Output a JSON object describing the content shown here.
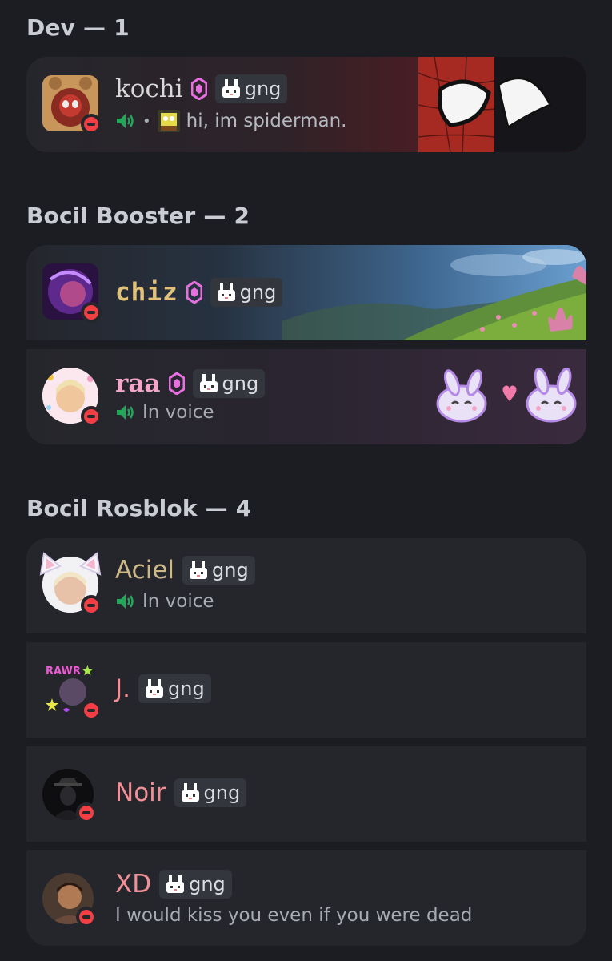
{
  "sections": [
    {
      "header": "Dev — 1"
    },
    {
      "header": "Bocil Booster — 2"
    },
    {
      "header": "Bocil Rosblok — 4"
    }
  ],
  "members": {
    "kochi": {
      "name": "kochi",
      "tag": "gng",
      "status_text": "hi, im spiderman.",
      "name_color": "#d9d9d9"
    },
    "chiz": {
      "name": "chiz",
      "tag": "gng",
      "name_color": "#e0c27a"
    },
    "raa": {
      "name": "raa",
      "tag": "gng",
      "status_text": "In voice",
      "name_color": "#f3a6c7"
    },
    "aciel": {
      "name": "Aciel",
      "tag": "gng",
      "status_text": "In voice",
      "name_color": "#cdb887"
    },
    "j": {
      "name": "J.",
      "tag": "gng",
      "name_color": "#f08f95"
    },
    "noir": {
      "name": "Noir",
      "tag": "gng",
      "name_color": "#f08f95"
    },
    "xd": {
      "name": "XD",
      "tag": "gng",
      "status_text": "I would kiss you even if you were dead",
      "name_color": "#f08f95"
    }
  },
  "colors": {
    "background": "#1c1d22",
    "card": "#25262c",
    "dnd": "#f23f43",
    "booster": "#e86fe0",
    "voice": "#23a55a"
  },
  "icons": {
    "booster": "server-boost-icon",
    "tag": "bunny-icon",
    "voice": "voice-icon",
    "status": "do-not-disturb-icon"
  }
}
